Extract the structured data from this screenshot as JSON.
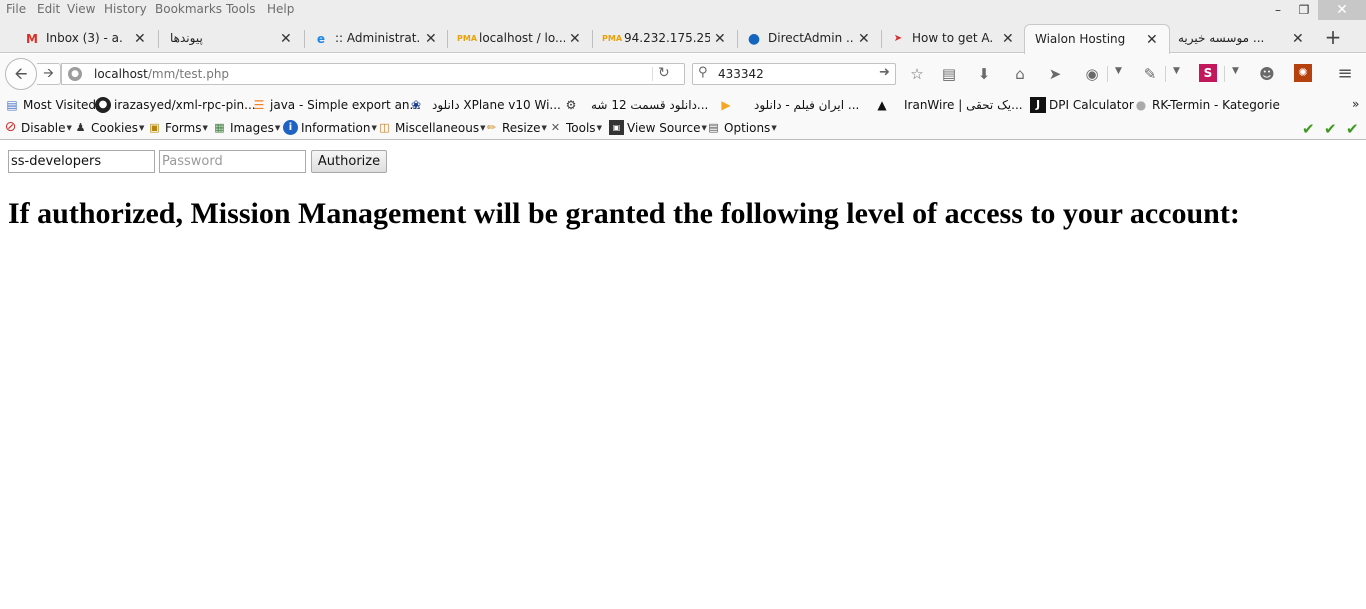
{
  "menubar": {
    "items": [
      "File",
      "Edit",
      "View",
      "History",
      "Bookmarks",
      "Tools",
      "Help"
    ]
  },
  "tabs": [
    {
      "title": "Inbox (3) - a...",
      "icon": "gmail-icon"
    },
    {
      "title": "پیوندها",
      "icon": "none"
    },
    {
      "title": ":: Administrat...",
      "icon": "ie-icon"
    },
    {
      "title": "localhost / lo...",
      "icon": "phpmyadmin-icon"
    },
    {
      "title": "94.232.175.25...",
      "icon": "phpmyadmin-icon"
    },
    {
      "title": "DirectAdmin ...",
      "icon": "directadmin-icon"
    },
    {
      "title": "How to get A...",
      "icon": "arrows-icon"
    },
    {
      "title": "Wialon Hosting",
      "icon": "none"
    },
    {
      "title": "موسسه خیریه ...",
      "icon": "none"
    }
  ],
  "navbar": {
    "url_host": "localhost",
    "url_path": "/mm/test.php",
    "search_value": "433342"
  },
  "bookmarks": [
    {
      "label": "Most Visited",
      "icon": "most-visited-icon"
    },
    {
      "label": "irazasyed/xml-rpc-pin...",
      "icon": "github-icon"
    },
    {
      "label": "java - Simple export an...",
      "icon": "stackoverflow-icon"
    },
    {
      "label": "دانلود XPlane v10 Wi...",
      "icon": "site-icon"
    },
    {
      "label": "دانلود قسمت 12 شه...",
      "icon": "transformers-icon"
    },
    {
      "label": "ایران فیلم - دانلود ...",
      "icon": "play-icon"
    },
    {
      "label": "IranWire | یک تحقی...",
      "icon": "triangle-icon"
    },
    {
      "label": "DPI Calculator",
      "icon": "j-icon"
    },
    {
      "label": "RK-Termin - Kategorie",
      "icon": "globe-icon"
    }
  ],
  "devbar": [
    {
      "label": "Disable",
      "icon": "disable-icon"
    },
    {
      "label": "Cookies",
      "icon": "cookies-icon"
    },
    {
      "label": "Forms",
      "icon": "forms-icon"
    },
    {
      "label": "Images",
      "icon": "images-icon"
    },
    {
      "label": "Information",
      "icon": "information-icon"
    },
    {
      "label": "Miscellaneous",
      "icon": "miscellaneous-icon"
    },
    {
      "label": "Resize",
      "icon": "resize-icon"
    },
    {
      "label": "Tools",
      "icon": "tools-icon"
    },
    {
      "label": "View Source",
      "icon": "view-source-icon"
    },
    {
      "label": "Options",
      "icon": "options-icon"
    }
  ],
  "page": {
    "username_value": "ss-developers",
    "password_placeholder": "Password",
    "authorize_label": "Authorize",
    "heading": "If authorized, Mission Management will be granted the following level of access to your account:"
  }
}
